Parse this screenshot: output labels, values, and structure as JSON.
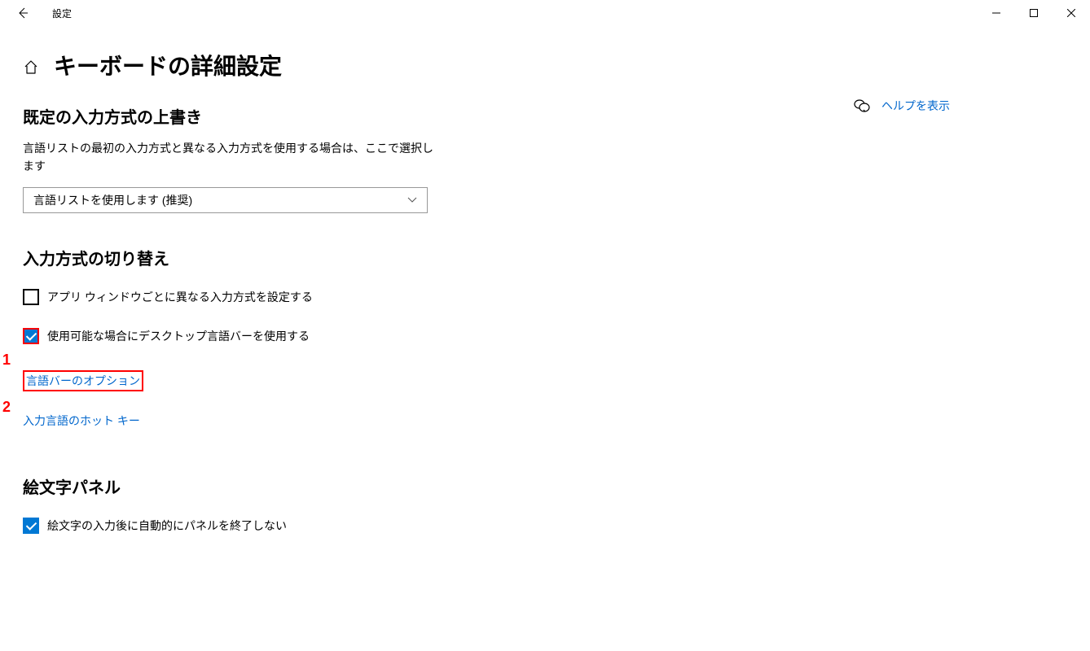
{
  "titlebar": {
    "app_title": "設定"
  },
  "page": {
    "title": "キーボードの詳細設定"
  },
  "section1": {
    "title": "既定の入力方式の上書き",
    "desc": "言語リストの最初の入力方式と異なる入力方式を使用する場合は、ここで選択します",
    "dropdown_value": "言語リストを使用します (推奨)"
  },
  "section2": {
    "title": "入力方式の切り替え",
    "checkbox1_label": "アプリ ウィンドウごとに異なる入力方式を設定する",
    "checkbox1_checked": false,
    "checkbox2_label": "使用可能な場合にデスクトップ言語バーを使用する",
    "checkbox2_checked": true,
    "link1": "言語バーのオプション",
    "link2": "入力言語のホット キー"
  },
  "section3": {
    "title": "絵文字パネル",
    "checkbox1_label": "絵文字の入力後に自動的にパネルを終了しない",
    "checkbox1_checked": true
  },
  "side": {
    "help_link": "ヘルプを表示"
  },
  "annotations": {
    "a1": "1",
    "a2": "2"
  }
}
